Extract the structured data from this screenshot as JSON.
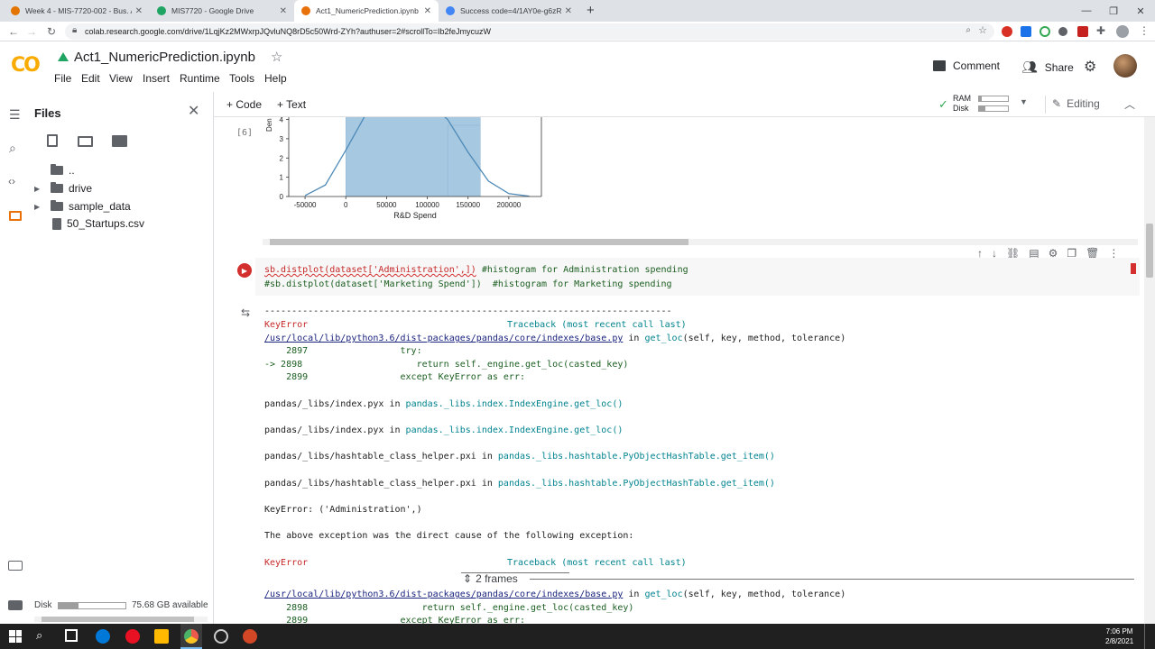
{
  "browser": {
    "tabs": [
      {
        "title": "Week 4 - MIS-7720-002 - Bus. An",
        "fav_color": "#e37400"
      },
      {
        "title": "MIS7720 - Google Drive",
        "fav_color": "#1fa463"
      },
      {
        "title": "Act1_NumericPrediction.ipynb - C",
        "fav_color": "#e8710a"
      },
      {
        "title": "Success code=4/1AY0e-g6zROt-",
        "fav_color": "#4285f4"
      }
    ],
    "new_tab": "+",
    "url": "colab.research.google.com/drive/1LqjKz2MWxrpJQvluNQ8rD5c50Wrd-ZYh?authuser=2#scrollTo=Ib2feJmycuzW"
  },
  "header": {
    "logo": "CO",
    "title": "Act1_NumericPrediction.ipynb",
    "menus": [
      "File",
      "Edit",
      "View",
      "Insert",
      "Runtime",
      "Tools",
      "Help"
    ],
    "comment": "Comment",
    "share": "Share"
  },
  "toolbar": {
    "code": "+ Code",
    "text": "+ Text",
    "ram": "RAM",
    "disk": "Disk",
    "editing": "Editing"
  },
  "files": {
    "title": "Files",
    "tree": [
      {
        "label": "..",
        "type": "up"
      },
      {
        "label": "drive",
        "type": "folder"
      },
      {
        "label": "sample_data",
        "type": "folder"
      },
      {
        "label": "50_Startups.csv",
        "type": "file"
      }
    ],
    "disk_label": "Disk",
    "disk_available": "75.68 GB available"
  },
  "prev_cell": {
    "exec_count": "[6]",
    "ylabel": "Den",
    "xlabel": "R&D Spend"
  },
  "chart_data": {
    "type": "area",
    "xlabel": "R&D Spend",
    "ylabel": "Den",
    "x_ticks": [
      "-50000",
      "0",
      "50000",
      "100000",
      "150000",
      "200000"
    ],
    "y_ticks": [
      "0",
      "1",
      "2",
      "3",
      "4"
    ],
    "ylim": [
      0,
      4.4
    ],
    "xlim": [
      -70000,
      240000
    ],
    "bars": [
      {
        "x0": 0,
        "x1": 165000,
        "height": 4.4
      },
      {
        "x0": 125000,
        "x1": 165000,
        "height": 3.7
      }
    ],
    "kde_x": [
      -50000,
      -25000,
      0,
      25000,
      50000,
      75000,
      100000,
      125000,
      150000,
      175000,
      200000,
      225000
    ],
    "kde_y": [
      0.05,
      0.6,
      2.4,
      4.3,
      5.0,
      5.0,
      4.9,
      4.0,
      2.3,
      0.8,
      0.15,
      0.02
    ],
    "colors": {
      "bar": "#a6c8e0",
      "kde": "#4e8ab8"
    }
  },
  "code_cell": {
    "line1_code": "sb.distplot(dataset['Administration',])",
    "line1_comment": " #histogram for Administration spending",
    "line2": "#sb.distplot(dataset['Marketing Spend'])  #histogram for Marketing spending"
  },
  "output": {
    "dashes": "---------------------------------------------------------------------------",
    "error_name": "KeyError",
    "traceback_header": "Traceback (most recent call last)",
    "file1": "/usr/local/lib/python3.6/dist-packages/pandas/core/indexes/base.py",
    "in": " in ",
    "get_loc": "get_loc",
    "get_loc_args": "(self, key, method, tolerance)",
    "l2897": "    2897                 try:",
    "l2898": "-> 2898                     return self._engine.get_loc(casted_key)",
    "l2899": "    2899                 except KeyError as err:",
    "pyx1_file": "pandas/_libs/index.pyx",
    "pyx1_func": "pandas._libs.index.IndexEngine.get_loc()",
    "pyx2_file": "pandas/_libs/index.pyx",
    "pyx2_func": "pandas._libs.index.IndexEngine.get_loc()",
    "pxi1_file": "pandas/_libs/hashtable_class_helper.pxi",
    "pxi1_func": "pandas._libs.hashtable.PyObjectHashTable.get_item()",
    "pxi2_file": "pandas/_libs/hashtable_class_helper.pxi",
    "pxi2_func": "pandas._libs.hashtable.PyObjectHashTable.get_item()",
    "keyerror_line": "KeyError: ('Administration',)",
    "direct_cause": "The above exception was the direct cause of the following exception:",
    "frames": "2 frames",
    "l2898b": "    2898                     return self._engine.get_loc(casted_key)",
    "l2899b": "    2899                 except KeyError as err:"
  },
  "taskbar": {
    "time": "7:06 PM",
    "date": "2/8/2021"
  }
}
